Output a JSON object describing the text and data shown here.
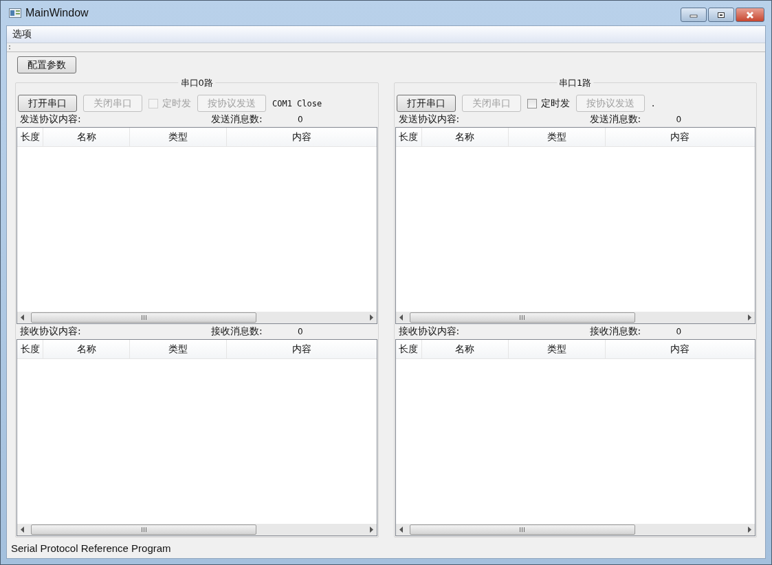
{
  "window": {
    "title": "MainWindow"
  },
  "menu": [
    {
      "label": "选项"
    }
  ],
  "config_button": {
    "label": "配置参数"
  },
  "ports": [
    {
      "title": "串口0路",
      "buttons": [
        {
          "label": "打开串口",
          "disabled": false
        },
        {
          "label": "关闭串口",
          "disabled": true
        }
      ],
      "timer": {
        "label": "定时发",
        "checked": false,
        "disabled": true
      },
      "send_button": {
        "label": "按协议发送",
        "disabled": true
      },
      "status": "COM1 Close",
      "tables": [
        {
          "label": "发送协议内容:",
          "count_label": "发送消息数:",
          "count": "0",
          "columns": [
            "长度",
            "名称",
            "类型",
            "内容"
          ]
        },
        {
          "label": "接收协议内容:",
          "count_label": "接收消息数:",
          "count": "0",
          "columns": [
            "长度",
            "名称",
            "类型",
            "内容"
          ]
        }
      ]
    },
    {
      "title": "串口1路",
      "buttons": [
        {
          "label": "打开串口",
          "disabled": false
        },
        {
          "label": "关闭串口",
          "disabled": true
        }
      ],
      "timer": {
        "label": "定时发",
        "checked": false,
        "disabled": false
      },
      "send_button": {
        "label": "按协议发送",
        "disabled": true
      },
      "status": ".",
      "tables": [
        {
          "label": "发送协议内容:",
          "count_label": "发送消息数:",
          "count": "0",
          "columns": [
            "长度",
            "名称",
            "类型",
            "内容"
          ]
        },
        {
          "label": "接收协议内容:",
          "count_label": "接收消息数:",
          "count": "0",
          "columns": [
            "长度",
            "名称",
            "类型",
            "内容"
          ]
        }
      ]
    }
  ],
  "status_bar": {
    "text": "Serial Protocol Reference Program"
  }
}
